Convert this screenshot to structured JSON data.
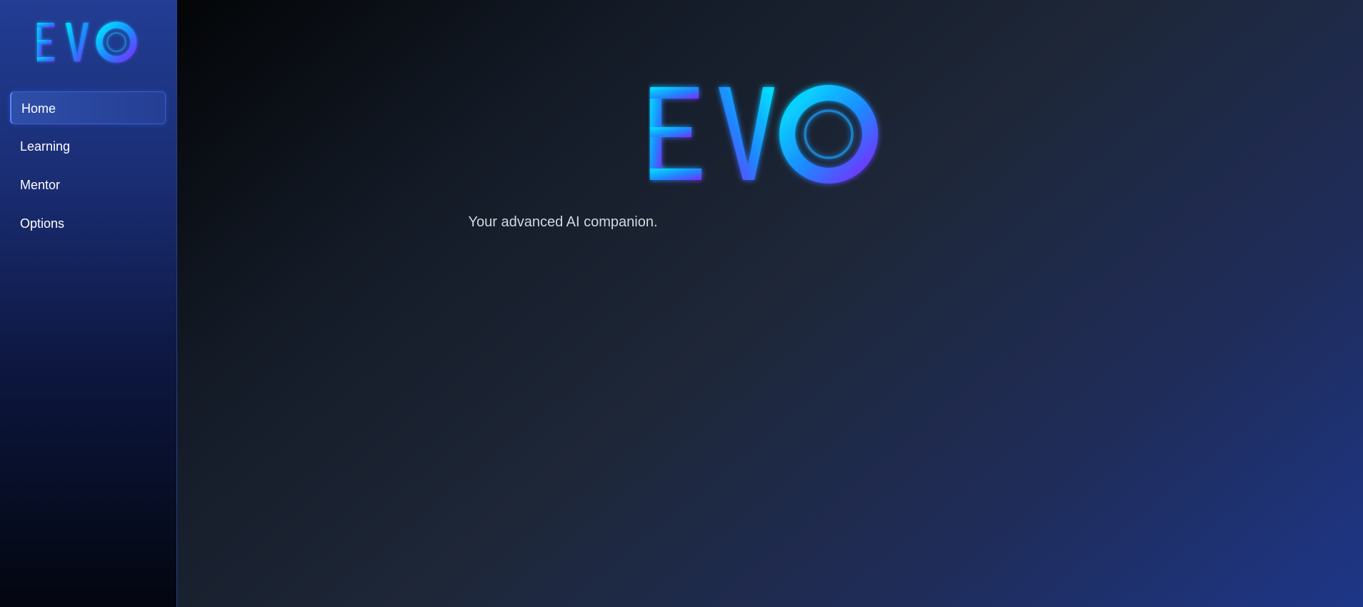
{
  "app": {
    "logo_text": "EVO"
  },
  "sidebar": {
    "items": [
      {
        "label": "Home",
        "active": true
      },
      {
        "label": "Learning",
        "active": false
      },
      {
        "label": "Mentor",
        "active": false
      },
      {
        "label": "Options",
        "active": false
      }
    ]
  },
  "main": {
    "tagline": "Your advanced AI companion."
  },
  "colors": {
    "logo_cyan": "#00e5ff",
    "logo_blue": "#1e88ff",
    "logo_violet": "#7a2cff",
    "sidebar_top": "#223d94",
    "main_accent": "#1e3688"
  }
}
